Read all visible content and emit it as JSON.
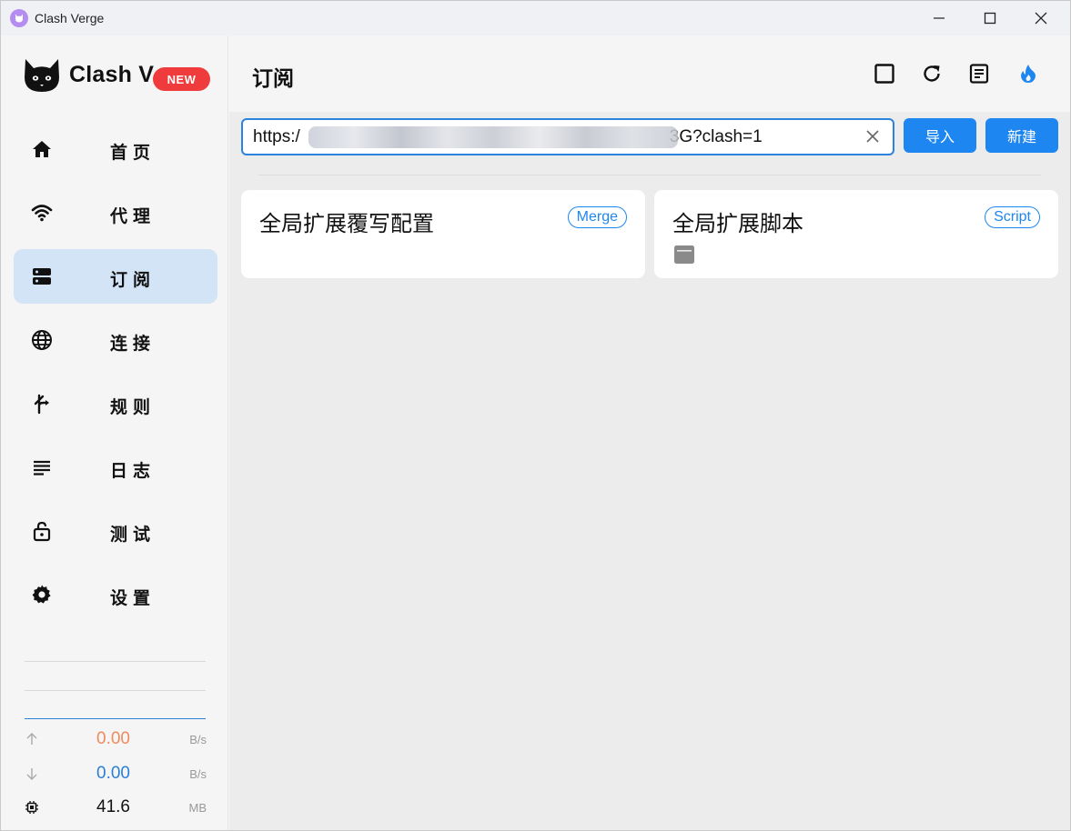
{
  "window": {
    "title": "Clash Verge"
  },
  "brand": {
    "name": "Clash V",
    "badge": "NEW"
  },
  "nav": [
    {
      "label": "首页",
      "icon": "home-icon"
    },
    {
      "label": "代理",
      "icon": "wifi-icon"
    },
    {
      "label": "订阅",
      "icon": "storage-icon",
      "active": true
    },
    {
      "label": "连接",
      "icon": "globe-icon"
    },
    {
      "label": "规则",
      "icon": "fork-arrow-icon"
    },
    {
      "label": "日志",
      "icon": "lines-icon"
    },
    {
      "label": "测试",
      "icon": "lock-icon"
    },
    {
      "label": "设置",
      "icon": "gear-icon"
    }
  ],
  "stats": {
    "upload": {
      "value": "0.00",
      "unit": "B/s",
      "color": "#f08a5d"
    },
    "download": {
      "value": "0.00",
      "unit": "B/s",
      "color": "#2b7fd8"
    },
    "memory": {
      "value": "41.6",
      "unit": "MB"
    }
  },
  "page": {
    "title": "订阅"
  },
  "header_buttons": [
    "square-icon",
    "refresh-icon",
    "document-icon",
    "fire-icon"
  ],
  "url_input": {
    "prefix": "https:/",
    "suffix": "3G?clash=1"
  },
  "buttons": {
    "import": "导入",
    "new": "新建"
  },
  "cards": [
    {
      "title": "全局扩展覆写配置",
      "tag": "Merge"
    },
    {
      "title": "全局扩展脚本",
      "tag": "Script",
      "sub_icon": "terminal-icon"
    }
  ],
  "colors": {
    "accent": "#1e86f0",
    "active_nav_bg": "#d3e4f6",
    "badge_red": "#ef3b3b"
  }
}
